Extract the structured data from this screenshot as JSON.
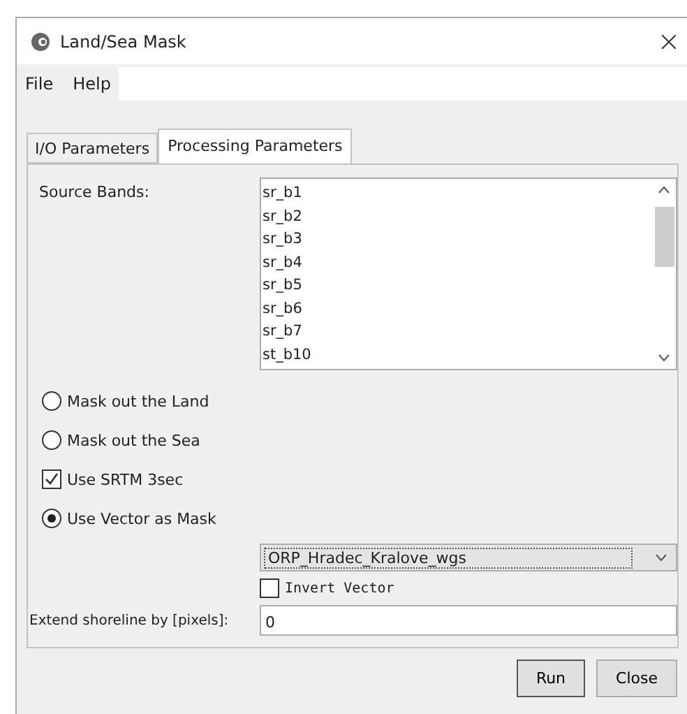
{
  "window": {
    "title": "Land/Sea Mask"
  },
  "menu": [
    "File",
    "Help"
  ],
  "tabs": [
    {
      "label": "I/O Parameters",
      "selected": false
    },
    {
      "label": "Processing Parameters",
      "selected": true
    }
  ],
  "source_bands": {
    "label": "Source Bands:",
    "items": [
      "sr_b1",
      "sr_b2",
      "sr_b3",
      "sr_b4",
      "sr_b5",
      "sr_b6",
      "sr_b7",
      "st_b10"
    ]
  },
  "options": [
    {
      "kind": "radio",
      "label": "Mask out the Land",
      "checked": false
    },
    {
      "kind": "radio",
      "label": "Mask out the Sea",
      "checked": false
    },
    {
      "kind": "checkbox",
      "label": "Use SRTM 3sec",
      "checked": true
    },
    {
      "kind": "radio",
      "label": "Use Vector as Mask",
      "checked": true
    }
  ],
  "vector": {
    "value": "ORP_Hradec_Kralove_wgs"
  },
  "invert_vector": {
    "label": "Invert Vector",
    "checked": false
  },
  "shoreline": {
    "label": "Extend shoreline by [pixels]:",
    "value": "0"
  },
  "buttons": [
    "Run",
    "Close"
  ]
}
